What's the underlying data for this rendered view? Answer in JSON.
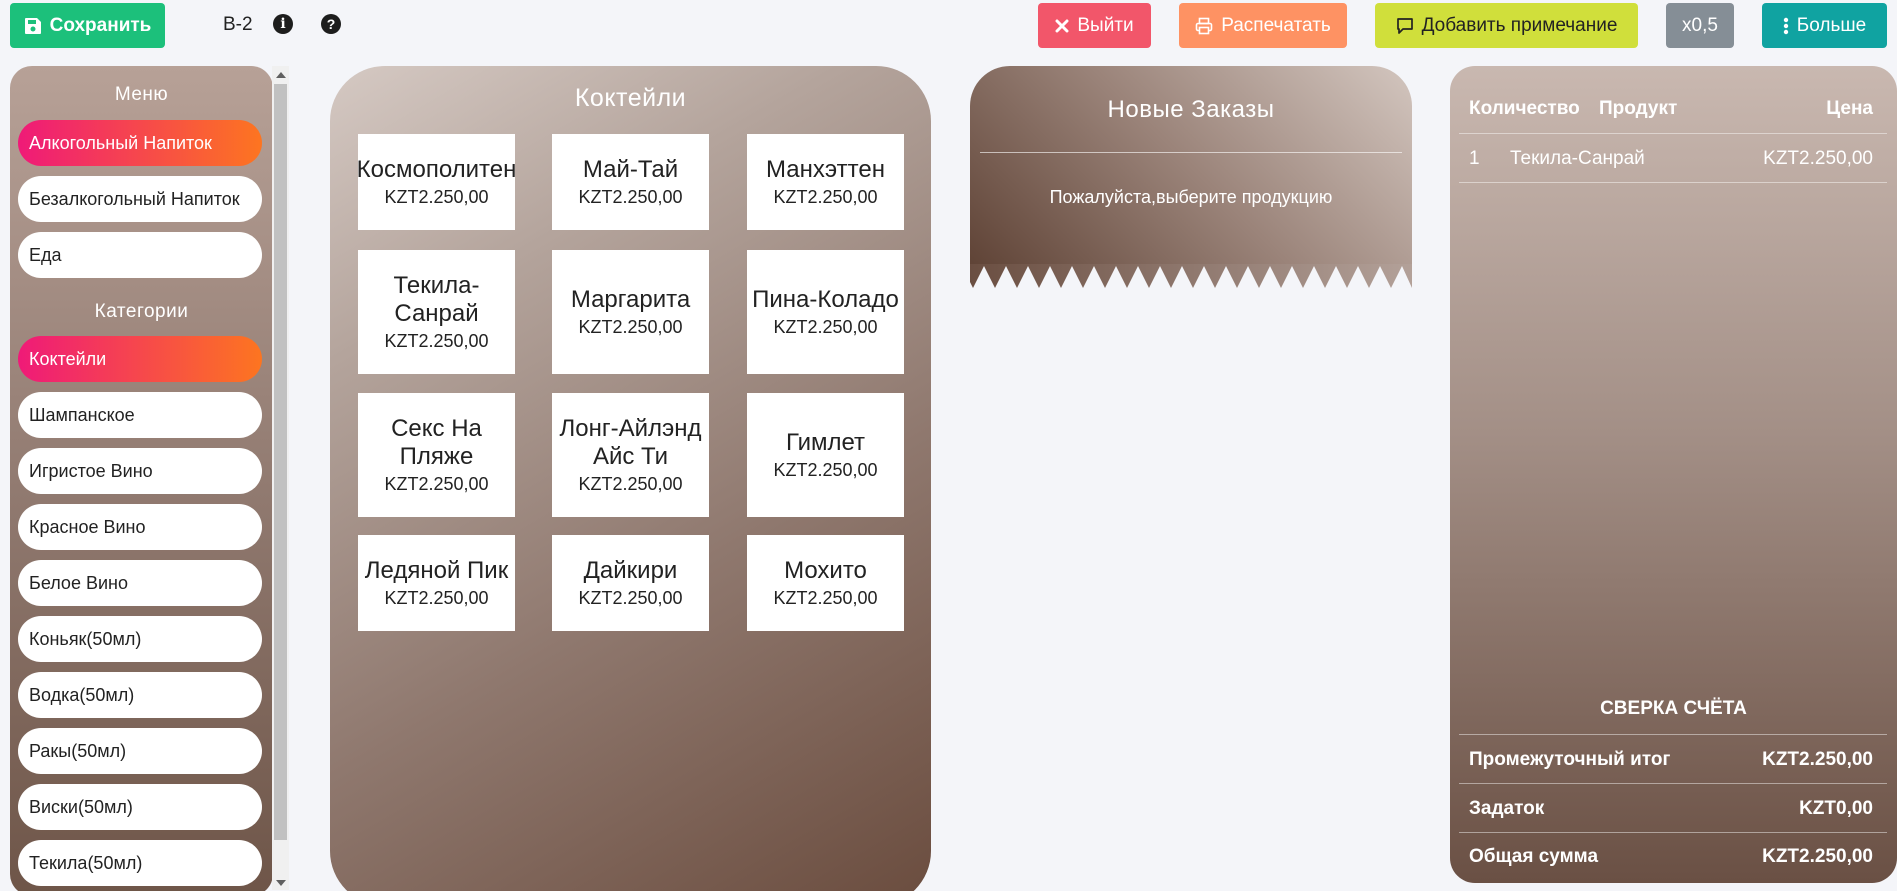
{
  "toolbar": {
    "save_label": "Сохранить",
    "table_label": "B-2",
    "exit_label": "Выйти",
    "print_label": "Распечатать",
    "note_label": "Добавить примечание",
    "zoom_label": "x0,5",
    "more_label": "Больше",
    "icons": [
      "save-icon",
      "info-icon",
      "help-icon",
      "close-icon",
      "printer-icon",
      "comment-icon",
      "vertical-dots-icon"
    ]
  },
  "sidebar": {
    "menu_heading": "Меню",
    "menu_items": [
      {
        "label": "Алкогольный Напиток",
        "active": true
      },
      {
        "label": "Безалкогольный Напиток",
        "active": false
      },
      {
        "label": "Еда",
        "active": false
      }
    ],
    "categories_heading": "Категории",
    "categories": [
      {
        "label": "Коктейли",
        "active": true
      },
      {
        "label": "Шампанское",
        "active": false
      },
      {
        "label": "Игристое Вино",
        "active": false
      },
      {
        "label": "Красное Вино",
        "active": false
      },
      {
        "label": "Белое Вино",
        "active": false
      },
      {
        "label": "Коньяк(50мл)",
        "active": false
      },
      {
        "label": "Водка(50мл)",
        "active": false
      },
      {
        "label": "Ракы(50мл)",
        "active": false
      },
      {
        "label": "Виски(50мл)",
        "active": false
      },
      {
        "label": "Текила(50мл)",
        "active": false
      }
    ]
  },
  "cocktails": {
    "title": "Коктейли",
    "products": [
      {
        "name": "Космополитен",
        "price": "KZT2.250,00"
      },
      {
        "name": "Май-Тай",
        "price": "KZT2.250,00"
      },
      {
        "name": "Манхэттен",
        "price": "KZT2.250,00"
      },
      {
        "name": "Текила-Санрай",
        "price": "KZT2.250,00"
      },
      {
        "name": "Маргарита",
        "price": "KZT2.250,00"
      },
      {
        "name": "Пина-Коладо",
        "price": "KZT2.250,00"
      },
      {
        "name": "Секс На Пляже",
        "price": "KZT2.250,00"
      },
      {
        "name": "Лонг-Айлэнд Айс Ти",
        "price": "KZT2.250,00"
      },
      {
        "name": "Гимлет",
        "price": "KZT2.250,00"
      },
      {
        "name": "Ледяной Пик",
        "price": "KZT2.250,00"
      },
      {
        "name": "Дайкири",
        "price": "KZT2.250,00"
      },
      {
        "name": "Мохито",
        "price": "KZT2.250,00"
      }
    ]
  },
  "new_orders": {
    "title": "Новые Заказы",
    "message": "Пожалуйста,выберите продукцию"
  },
  "receipt": {
    "headers": {
      "qty": "Количество",
      "product": "Продукт",
      "price": "Цена"
    },
    "items": [
      {
        "qty": "1",
        "product": "Текила-Санрай",
        "price": "KZT2.250,00"
      }
    ],
    "reconciliation_title": "СВЕРКА СЧЁТА",
    "subtotal_label": "Промежуточный итог",
    "subtotal_value": "KZT2.250,00",
    "deposit_label": "Задаток",
    "deposit_value": "KZT0,00",
    "total_label": "Общая сумма",
    "total_value": "KZT2.250,00"
  },
  "colors": {
    "save": "#1cc07b",
    "exit": "#f2566a",
    "print": "#fe9263",
    "note": "#d0df3b",
    "zoom": "#858e96",
    "more": "#10a3a1",
    "active_pill_start": "#ef1a78",
    "active_pill_end": "#fd7520"
  }
}
